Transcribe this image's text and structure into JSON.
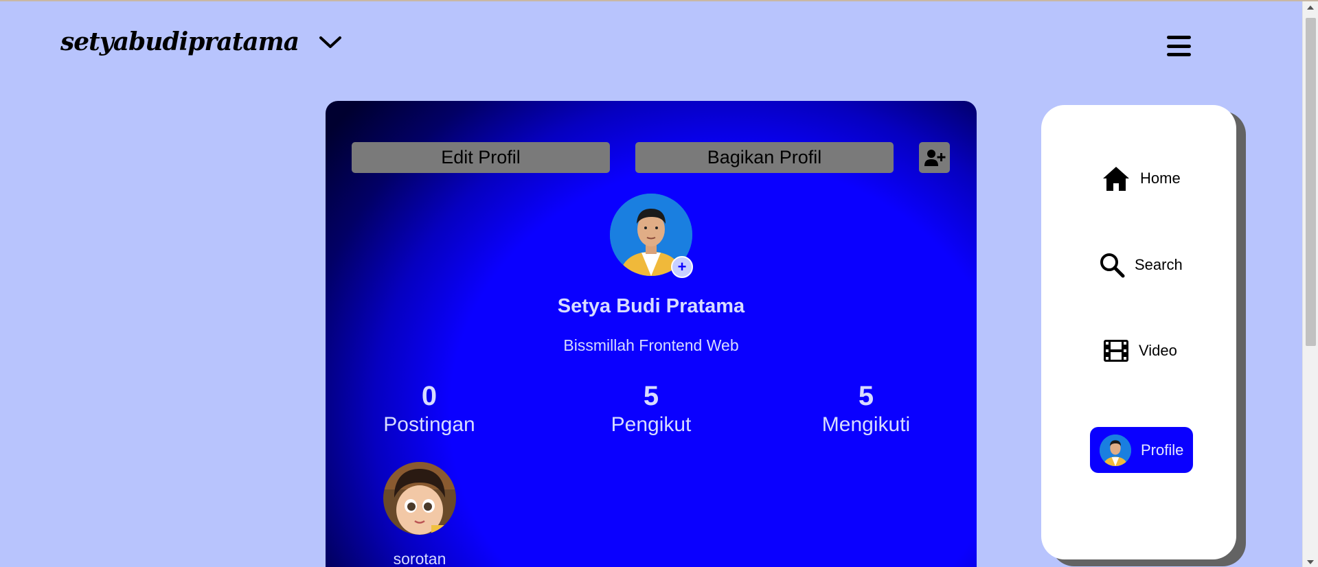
{
  "header": {
    "brand": "setyabudipratama",
    "dropdown_icon": "chevron-down-icon",
    "menu_icon": "hamburger-menu-icon"
  },
  "profile": {
    "edit_label": "Edit Profil",
    "share_label": "Bagikan Profil",
    "add_user_icon": "add-user-icon",
    "avatar_add_symbol": "+",
    "name": "Setya Budi Pratama",
    "bio": "Bissmillah Frontend Web",
    "stats": [
      {
        "value": "0",
        "label": "Postingan"
      },
      {
        "value": "5",
        "label": "Pengikut"
      },
      {
        "value": "5",
        "label": "Mengikuti"
      }
    ],
    "highlight_label": "sorotan"
  },
  "nav": {
    "items": [
      {
        "label": "Home",
        "icon": "home-icon"
      },
      {
        "label": "Search",
        "icon": "search-icon"
      },
      {
        "label": "Video",
        "icon": "film-icon"
      },
      {
        "label": "Profile",
        "icon": "avatar",
        "active": true
      }
    ]
  },
  "colors": {
    "page_bg": "#b8c4fd",
    "accent": "#0a00ff",
    "button_gray": "#7a7a7a",
    "text_light": "#d8dcff"
  }
}
